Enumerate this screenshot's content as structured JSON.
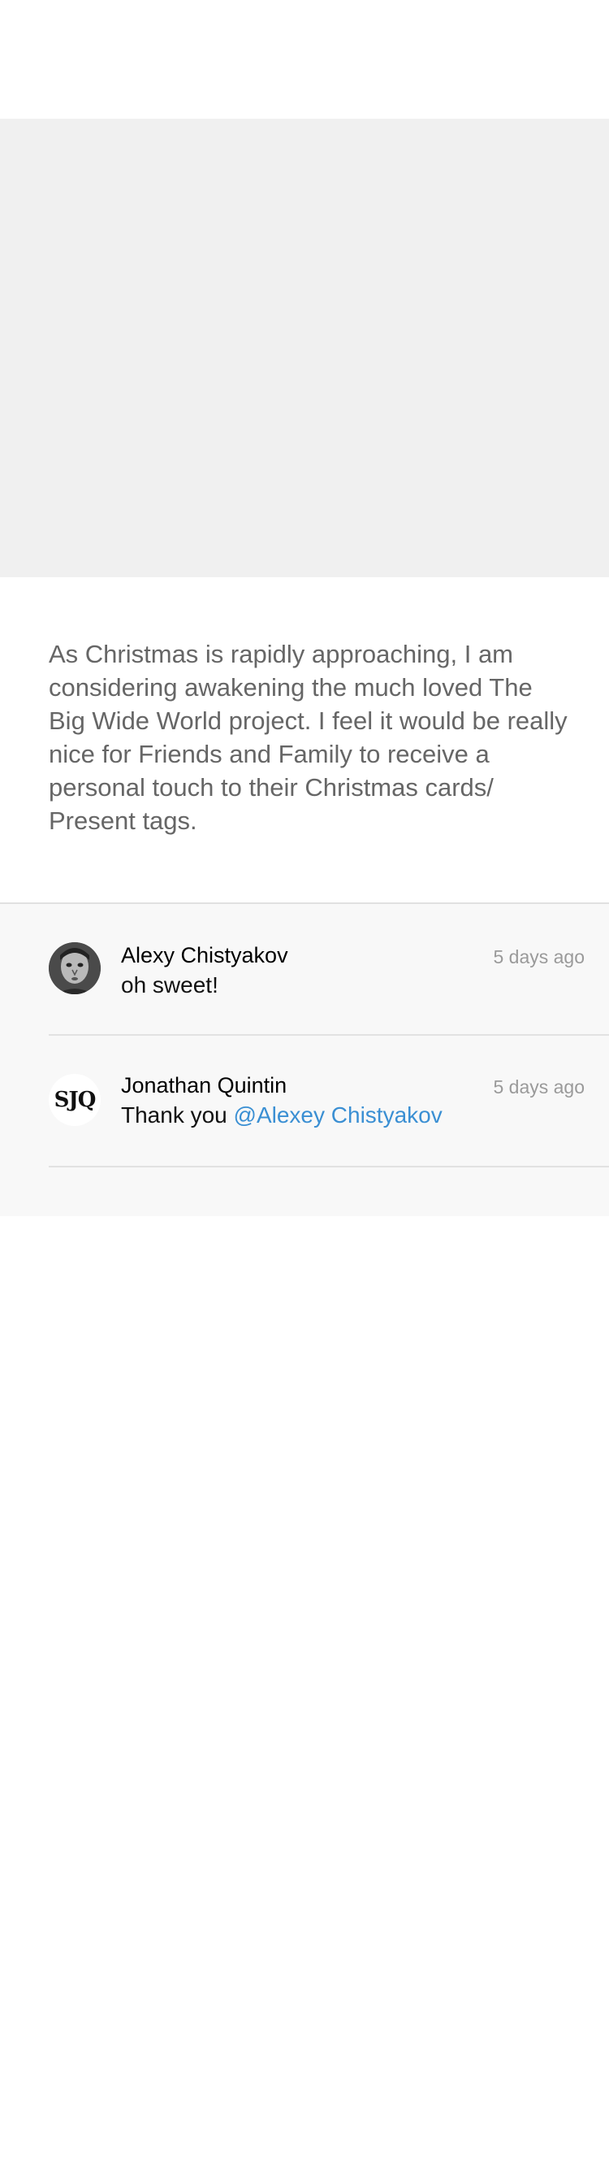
{
  "post": {
    "body": "As Christmas is rapidly approaching, I am considering awakening the much loved The Big Wide World project. I feel it would be really nice for Friends and Family to receive a personal touch to their Christmas cards/ Present tags."
  },
  "comments": [
    {
      "author": "Alexy Chistyakov",
      "time": "5 days ago",
      "text": "oh sweet!"
    },
    {
      "author": "Jonathan Quintin",
      "time": "5 days ago",
      "text": "Thank you ",
      "mention": "@Alexey Chistyakov",
      "avatar_monogram": "SJQ"
    }
  ],
  "colors": {
    "mention": "#3a8fd3",
    "hero_placeholder": "#f0f0f0",
    "comments_background": "#f8f8f8"
  }
}
